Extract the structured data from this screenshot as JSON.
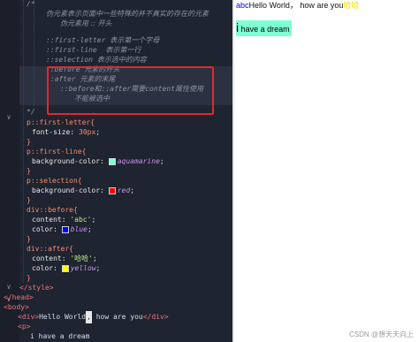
{
  "code": {
    "l_comment_open": "/*",
    "l_desc1": "伪元素表示页面中一些特殊的并不真实的存在的元素",
    "l_desc2": "伪元素用 :: 开头",
    "l_fl": "::first-letter 表示第一个字母",
    "l_fline": "::first-line  表示第一行",
    "l_selection": "::selection 表示选中的内容",
    "l_before": "::before 元素的开头",
    "l_after": "::after 元素的末尾",
    "l_note1": "::before和::after需要content属性使用",
    "l_note2": "不能被选中",
    "l_comment_close": "*/",
    "r1_sel": "p::first-letter{",
    "r1_prop": "font-size:",
    "r1_val": "30px",
    "close": "}",
    "r2_sel": "p::first-line{",
    "r2_prop": "background-color:",
    "r2_val": "aquamarine",
    "r3_sel": "p::selection{",
    "r3_prop": "background-color:",
    "r3_val": "red",
    "r4_sel": "div::before{",
    "r4_p1": "content:",
    "r4_v1": "'abc'",
    "r4_p2": "color:",
    "r4_v2": "blue",
    "r5_sel": "div::after{",
    "r5_p1": "content:",
    "r5_v1": "'哈哈'",
    "r5_p2": "color:",
    "r5_v2": "yellow",
    "style_close": "</style>",
    "head_close": "</head>",
    "body_open": "<body>",
    "div_open": "<div>",
    "div_text_a": "Hello World",
    "div_text_sel": ",",
    "div_text_b": " how are you",
    "div_close": "</div>",
    "p_open": "<p>",
    "p_text": "i have a dream"
  },
  "preview": {
    "before": "abc",
    "div_text": "Hello World， how are you",
    "after": "哈哈",
    "first_letter": "i",
    "p_rest": " have a dream"
  },
  "watermark": "CSDN @想天天向上",
  "colors": {
    "editor_bg": "#1e2430",
    "highlight_box": "#e0282e",
    "swatch_aquamarine": "#7fffd4",
    "swatch_red": "#ff0000",
    "swatch_blue": "#0000ff",
    "swatch_yellow": "#ffff00"
  }
}
